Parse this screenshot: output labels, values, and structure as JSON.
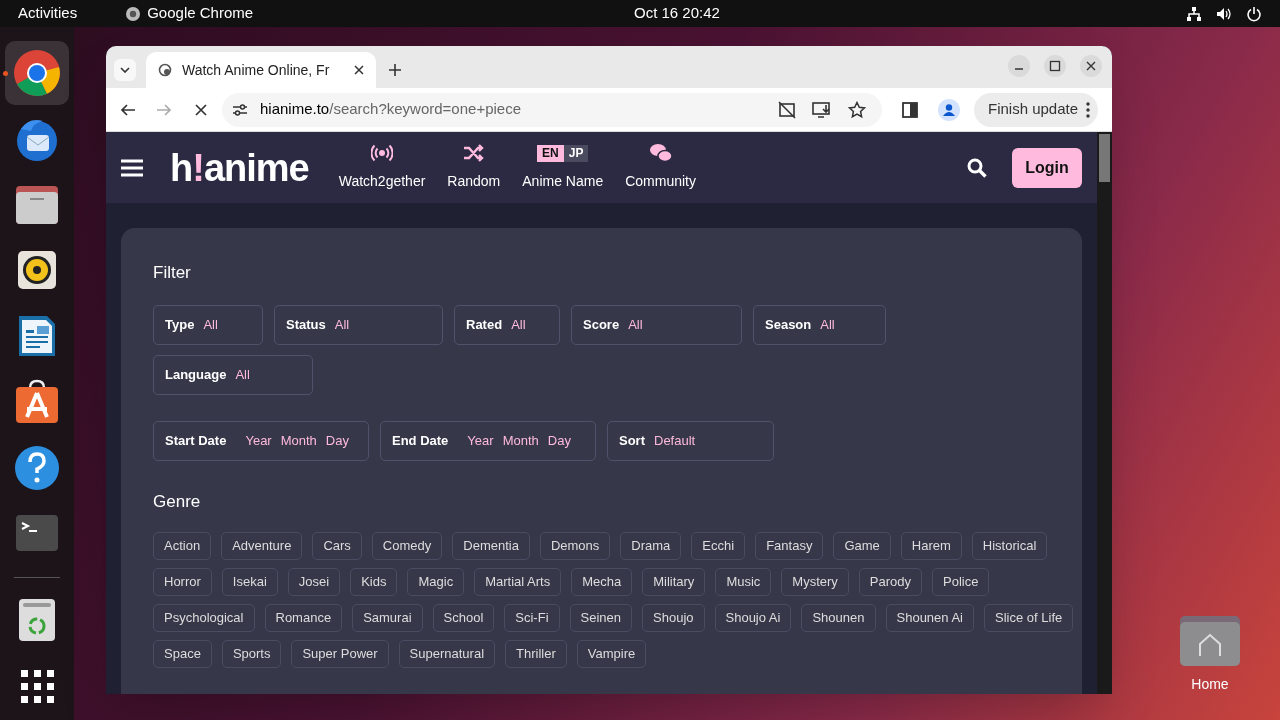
{
  "topbar": {
    "activities": "Activities",
    "app_name": "Google Chrome",
    "clock": "Oct 16  20:42"
  },
  "dock": {
    "items": [
      {
        "kind": "chrome",
        "running": true
      },
      {
        "kind": "mail",
        "running": false
      },
      {
        "kind": "files",
        "running": false
      },
      {
        "kind": "speaker",
        "running": false
      },
      {
        "kind": "writer",
        "running": false
      },
      {
        "kind": "store",
        "running": false
      },
      {
        "kind": "help",
        "running": false
      },
      {
        "kind": "terminal",
        "running": false
      },
      {
        "kind": "trash",
        "running": false
      },
      {
        "kind": "apps",
        "running": false
      }
    ]
  },
  "browser": {
    "tab_title": "Watch Anime Online, Fr",
    "url_host": "hianime.to",
    "url_path": "/search?keyword=one+piece",
    "update_button": "Finish update"
  },
  "site": {
    "logo": {
      "start": "h",
      "accent": "!",
      "end": "anime"
    },
    "nav": [
      {
        "kind": "broadcast",
        "label": "Watch2gether"
      },
      {
        "kind": "shuffle",
        "label": "Random"
      },
      {
        "kind": "lang",
        "label": "Anime Name",
        "toggle": [
          {
            "label": "EN",
            "selected": true
          },
          {
            "label": "JP",
            "selected": false
          }
        ]
      },
      {
        "kind": "chat",
        "label": "Community"
      }
    ],
    "login": "Login",
    "filter": {
      "title": "Filter",
      "selects": [
        {
          "label": "Type",
          "value": "All"
        },
        {
          "label": "Status",
          "value": "All"
        },
        {
          "label": "Rated",
          "value": "All"
        },
        {
          "label": "Score",
          "value": "All"
        },
        {
          "label": "Season",
          "value": "All"
        },
        {
          "label": "Language",
          "value": "All"
        }
      ],
      "dates": [
        {
          "label": "Start Date",
          "parts": [
            "Year",
            "Month",
            "Day"
          ]
        },
        {
          "label": "End Date",
          "parts": [
            "Year",
            "Month",
            "Day"
          ]
        }
      ],
      "sort": {
        "label": "Sort",
        "value": "Default"
      }
    },
    "genre_title": "Genre",
    "genre_rows": [
      [
        "Action",
        "Adventure",
        "Cars",
        "Comedy",
        "Dementia",
        "Demons",
        "Drama",
        "Ecchi",
        "Fantasy",
        "Game",
        "Harem",
        "Historical"
      ],
      [
        "Horror",
        "Isekai",
        "Josei",
        "Kids",
        "Magic",
        "Martial Arts",
        "Mecha",
        "Military",
        "Music",
        "Mystery",
        "Parody",
        "Police"
      ],
      [
        "Psychological",
        "Romance",
        "Samurai",
        "School",
        "Sci-Fi",
        "Seinen",
        "Shoujo",
        "Shoujo Ai",
        "Shounen",
        "Shounen Ai",
        "Slice of Life"
      ],
      [
        "Space",
        "Sports",
        "Super Power",
        "Supernatural",
        "Thriller",
        "Vampire"
      ]
    ]
  },
  "desktop_icon": {
    "label": "Home"
  }
}
